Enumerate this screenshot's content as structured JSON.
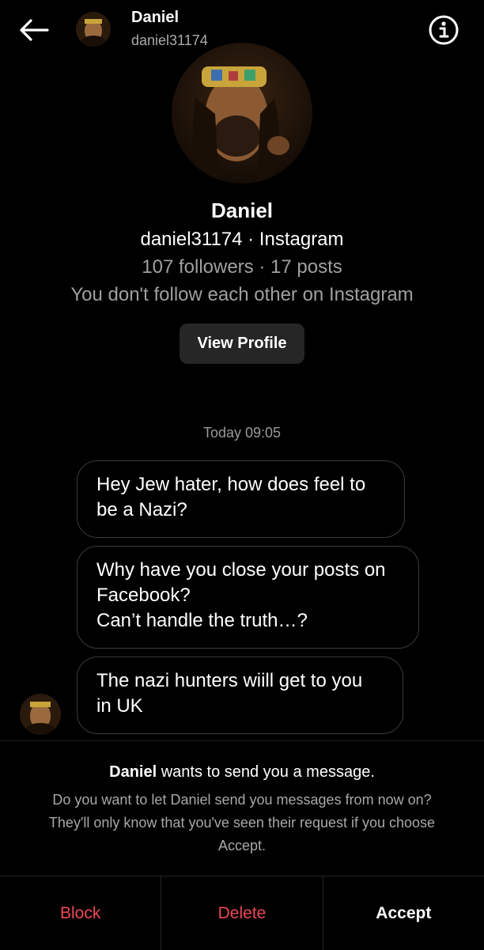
{
  "header": {
    "name": "Daniel",
    "username": "daniel31174",
    "icons": {
      "back": "arrow-left-icon",
      "info": "info-circle-icon"
    }
  },
  "profile": {
    "name": "Daniel",
    "subtitle": "daniel31174 · Instagram",
    "stats": "107 followers · 17 posts",
    "follow_status": "You don't follow each other on Instagram",
    "view_profile_label": "View Profile"
  },
  "conversation": {
    "timestamp": "Today 09:05",
    "messages": [
      {
        "text": "Hey Jew hater, how does feel to\nbe a Nazi?"
      },
      {
        "text": "Why have you close your posts on\nFacebook?\nCan’t handle the truth…?"
      },
      {
        "text": "The nazi hunters wiill get to you\nin UK"
      }
    ]
  },
  "request": {
    "title_name": "Daniel",
    "title_rest": " wants to send you a message.",
    "body": "Do you want to let Daniel send you messages from now on? They'll only know that you've seen their request if you choose Accept."
  },
  "actions": {
    "block": "Block",
    "delete": "Delete",
    "accept": "Accept"
  },
  "colors": {
    "background": "#000000",
    "danger": "#ed4956",
    "secondary_text": "#a0a0a0",
    "button_bg": "#262626"
  }
}
